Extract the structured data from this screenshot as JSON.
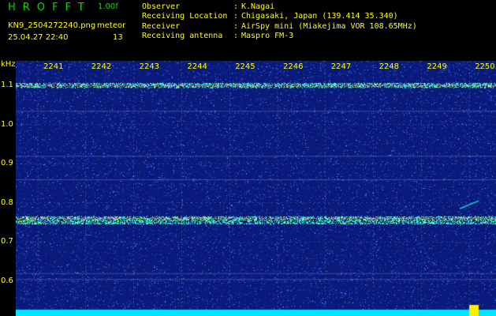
{
  "header": {
    "app_title": "HROFFT",
    "version": "1.00f",
    "filename": "KN9_2504272240.png",
    "timestamp": "25.04.27 22:40",
    "meteor_label": "meteor",
    "meteor_count": "13",
    "info": [
      {
        "key": "Observer",
        "value": "K.Nagai"
      },
      {
        "key": "Receiving Location",
        "value": "Chigasaki, Japan (139.414 35.340)"
      },
      {
        "key": "Receiver",
        "value": "AirSpy mini (Miakejima VOR 108.65MHz)"
      },
      {
        "key": "Receiving antenna",
        "value": "Maspro FM-3"
      }
    ]
  },
  "chart_data": {
    "type": "heatmap",
    "title": "",
    "xlabel": "",
    "ylabel": "kHz",
    "x_ticks": [
      "2241",
      "2242",
      "2243",
      "2244",
      "2245",
      "2246",
      "2247",
      "2248",
      "2249",
      "2250"
    ],
    "y_ticks": [
      "1.1",
      "1.0",
      "0.9",
      "0.8",
      "0.7",
      "0.6"
    ],
    "ylim": [
      0.58,
      1.17
    ],
    "carrier_lines_khz": [
      1.1,
      0.76
    ],
    "colors": {
      "background": "#0a1a7a",
      "noise": "#3366ff",
      "signal": "#00ffcc",
      "carrier": "#ff4444",
      "gridline": "#8899bb",
      "bottom_band": "#00e5ff",
      "labels": "#ffff00",
      "title": "#00d700"
    }
  }
}
